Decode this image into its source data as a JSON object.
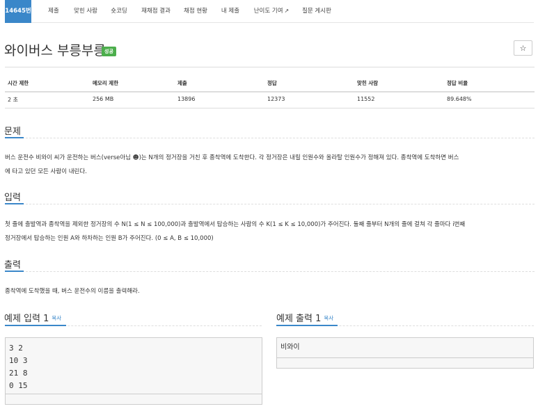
{
  "tabs": [
    {
      "label": "14645번",
      "active": true
    },
    {
      "label": "제출"
    },
    {
      "label": "맞힌 사람"
    },
    {
      "label": "숏코딩"
    },
    {
      "label": "재채점 결과"
    },
    {
      "label": "채점 현황"
    },
    {
      "label": "내 제출"
    },
    {
      "label": "난이도 기여"
    },
    {
      "label": "질문 게시판"
    }
  ],
  "problem": {
    "title": "와이버스 부릉부릉",
    "badge": "성공",
    "star": "☆"
  },
  "info": {
    "headers": [
      "시간 제한",
      "메모리 제한",
      "제출",
      "정답",
      "맞힌 사람",
      "정답 비율"
    ],
    "values": [
      "2 초",
      "256 MB",
      "13896",
      "12373",
      "11552",
      "89.648%"
    ]
  },
  "sections": {
    "problem_title": "문제",
    "problem_line1": "버스 운전수 비와이 씨가 운전하는 버스(verse아님 ☻)는 N개의 정거장을 거친 후 종착역에 도착한다. 각 정거장은 내릴 인원수와 올라탈 인원수가 정해져 있다. 종착역에 도착하면 버스",
    "problem_line2": "에 타고 있던 모든 사람이 내린다.",
    "input_title": "입력",
    "input_line1": "첫 줄에 출발역과 종착역을 제외한 정거장의 수 N(1 ≤ N ≤ 100,000)과 출발역에서 탑승하는 사람의 수 K(1 ≤ K ≤ 10,000)가 주어진다. 둘째 줄부터 N개의 줄에 걸쳐 각 줄마다 i번째",
    "input_line2": "정거장에서 탑승하는 인원 A와 하차하는 인원 B가 주어진다. (0 ≤ A, B ≤ 10,000)",
    "output_title": "출력",
    "output_line1": "종착역에 도착했을 때, 버스 운전수의 이름을 출력해라."
  },
  "samples": {
    "input_title": "예제 입력 1",
    "output_title": "예제 출력 1",
    "copy_label": "복사",
    "input_lines": [
      "3 2",
      "10 3",
      "21 8",
      "0 15"
    ],
    "output_text": "비와이"
  },
  "colors": {
    "accent": "#3a87c9",
    "badge": "#4cae4c"
  }
}
